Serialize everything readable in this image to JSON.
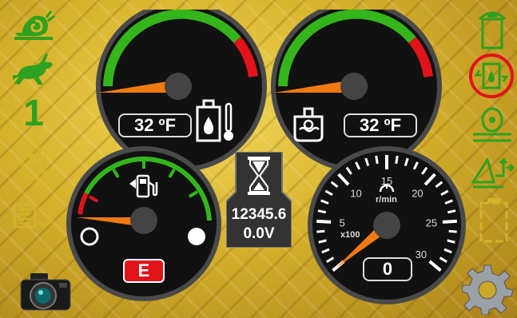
{
  "left_panel": {
    "gear_number": "1",
    "icons": [
      "snail-icon",
      "rabbit-icon",
      "glow-plug-icon",
      "exhaust-filter-icon",
      "camera-icon"
    ]
  },
  "right_panel": {
    "icons": [
      "cab-lift-icon",
      "hydraulic-oil-cycle-icon",
      "swing-lock-icon",
      "travel-alarm-icon",
      "battery-icon",
      "settings-gear-icon"
    ],
    "selected_icon": "hydraulic-oil-cycle-icon",
    "selection_color": "#e2131a"
  },
  "hydraulic_temp_gauge": {
    "readout": "32 ºF",
    "level_fraction": 0.06
  },
  "coolant_temp_gauge": {
    "readout": "32 ºF",
    "level_fraction": 0.06
  },
  "fuel_gauge": {
    "status_label": "E",
    "level_fraction": 0.04
  },
  "hour_meter": {
    "hours": "12345.6",
    "voltage": "0.0V"
  },
  "rpm_gauge": {
    "scale_labels": [
      "0",
      "5",
      "10",
      "15",
      "20",
      "25",
      "30"
    ],
    "unit": "r/min",
    "multiplier": "x100",
    "readout": "0",
    "value": 0
  },
  "colors": {
    "gauge_green": "#34b51c",
    "gauge_red": "#e2131a",
    "needle": "#f07a12",
    "icon_green": "#2fa01f"
  }
}
